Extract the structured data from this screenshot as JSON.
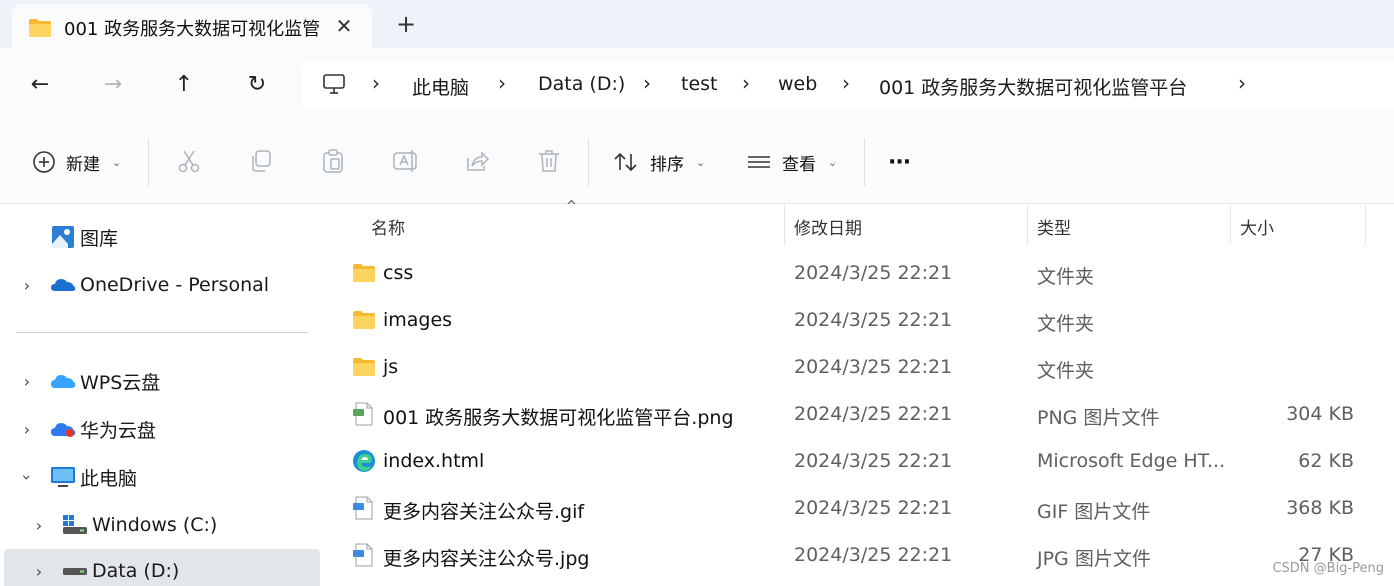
{
  "tab": {
    "title": "001 政务服务大数据可视化监管",
    "close_glyph": "✕",
    "new_tab_glyph": "+"
  },
  "nav": {
    "back_glyph": "←",
    "forward_glyph": "→",
    "up_glyph": "↑",
    "refresh_glyph": "↻"
  },
  "breadcrumb": [
    "此电脑",
    "Data (D:)",
    "test",
    "web",
    "001 政务服务大数据可视化监管平台"
  ],
  "commands": {
    "new_label": "新建",
    "sort_label": "排序",
    "view_label": "查看",
    "more_glyph": "···",
    "caret_glyph": "⌄"
  },
  "sidebar": {
    "items": [
      {
        "label": "图库",
        "icon": "gallery-icon"
      },
      {
        "label": "OneDrive - Personal",
        "icon": "onedrive-icon"
      },
      {
        "label": "WPS云盘",
        "icon": "wps-cloud-icon"
      },
      {
        "label": "华为云盘",
        "icon": "huawei-cloud-icon"
      },
      {
        "label": "此电脑",
        "icon": "computer-icon"
      },
      {
        "label": "Windows (C:)",
        "icon": "drive-icon"
      },
      {
        "label": "Data (D:)",
        "icon": "drive-icon"
      }
    ]
  },
  "columns": {
    "name": "名称",
    "modified": "修改日期",
    "type": "类型",
    "size": "大小"
  },
  "files": [
    {
      "name": "css",
      "modified": "2024/3/25 22:21",
      "type": "文件夹",
      "size": "",
      "icon": "folder-icon"
    },
    {
      "name": "images",
      "modified": "2024/3/25 22:21",
      "type": "文件夹",
      "size": "",
      "icon": "folder-icon"
    },
    {
      "name": "js",
      "modified": "2024/3/25 22:21",
      "type": "文件夹",
      "size": "",
      "icon": "folder-icon"
    },
    {
      "name": "001 政务服务大数据可视化监管平台.png",
      "modified": "2024/3/25 22:21",
      "type": "PNG 图片文件",
      "size": "304 KB",
      "icon": "png-file-icon"
    },
    {
      "name": "index.html",
      "modified": "2024/3/25 22:21",
      "type": "Microsoft Edge HT...",
      "size": "62 KB",
      "icon": "edge-icon"
    },
    {
      "name": "更多内容关注公众号.gif",
      "modified": "2024/3/25 22:21",
      "type": "GIF 图片文件",
      "size": "368 KB",
      "icon": "gif-file-icon"
    },
    {
      "name": "更多内容关注公众号.jpg",
      "modified": "2024/3/25 22:21",
      "type": "JPG 图片文件",
      "size": "27 KB",
      "icon": "jpg-file-icon"
    }
  ],
  "watermark": "CSDN @Big-Peng",
  "colors": {
    "accent": "#0067c0",
    "folder": "#f8c44f",
    "selected": "#e2e6ea"
  }
}
